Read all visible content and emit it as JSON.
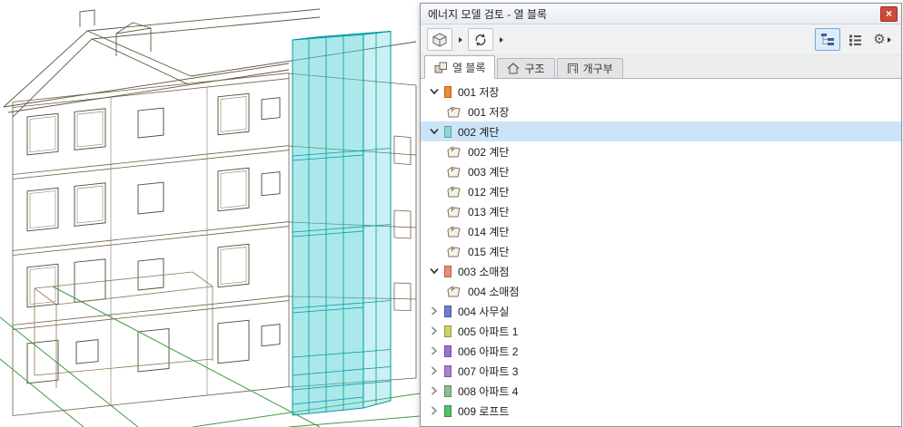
{
  "panel": {
    "title": "에너지 모델 검토 - 열 블록",
    "close_glyph": "×"
  },
  "icons": {
    "gear": "⚙"
  },
  "tabs": [
    {
      "label": "열 블록",
      "active": true
    },
    {
      "label": "구조",
      "active": false
    },
    {
      "label": "개구부",
      "active": false
    }
  ],
  "tree": {
    "rows": [
      {
        "type": "group",
        "expanded": true,
        "selected": false,
        "color": "#ef8b31",
        "label": "001 저장"
      },
      {
        "type": "item",
        "label": "001 저장"
      },
      {
        "type": "group",
        "expanded": true,
        "selected": true,
        "color": "#8fd8d2",
        "label": "002 계단"
      },
      {
        "type": "item",
        "label": "002 계단"
      },
      {
        "type": "item",
        "label": "003 계단"
      },
      {
        "type": "item",
        "label": "012 계단"
      },
      {
        "type": "item",
        "label": "013 계단"
      },
      {
        "type": "item",
        "label": "014 계단"
      },
      {
        "type": "item",
        "label": "015 계단"
      },
      {
        "type": "group",
        "expanded": true,
        "selected": false,
        "color": "#e98c76",
        "label": "003 소매점"
      },
      {
        "type": "item",
        "label": "004 소매점"
      },
      {
        "type": "group",
        "expanded": false,
        "selected": false,
        "color": "#6a7fd2",
        "label": "004 사무실"
      },
      {
        "type": "group",
        "expanded": false,
        "selected": false,
        "color": "#cfd06a",
        "label": "005 아파트 1"
      },
      {
        "type": "group",
        "expanded": false,
        "selected": false,
        "color": "#9d6fd4",
        "label": "006 아파트 2"
      },
      {
        "type": "group",
        "expanded": false,
        "selected": false,
        "color": "#a97fd9",
        "label": "007 아파트 3"
      },
      {
        "type": "group",
        "expanded": false,
        "selected": false,
        "color": "#8bbf8b",
        "label": "008 아파트 4"
      },
      {
        "type": "group",
        "expanded": false,
        "selected": false,
        "color": "#55c06a",
        "label": "009 로프트"
      }
    ]
  },
  "colors": {
    "selection_bg": "#cbe4f9",
    "selected_button_bg": "#dcecfb",
    "accent_border": "#74a7d8",
    "close_bg": "#d14836",
    "zone_fill": "#58d1d6",
    "zone_edge": "#009aa2"
  }
}
